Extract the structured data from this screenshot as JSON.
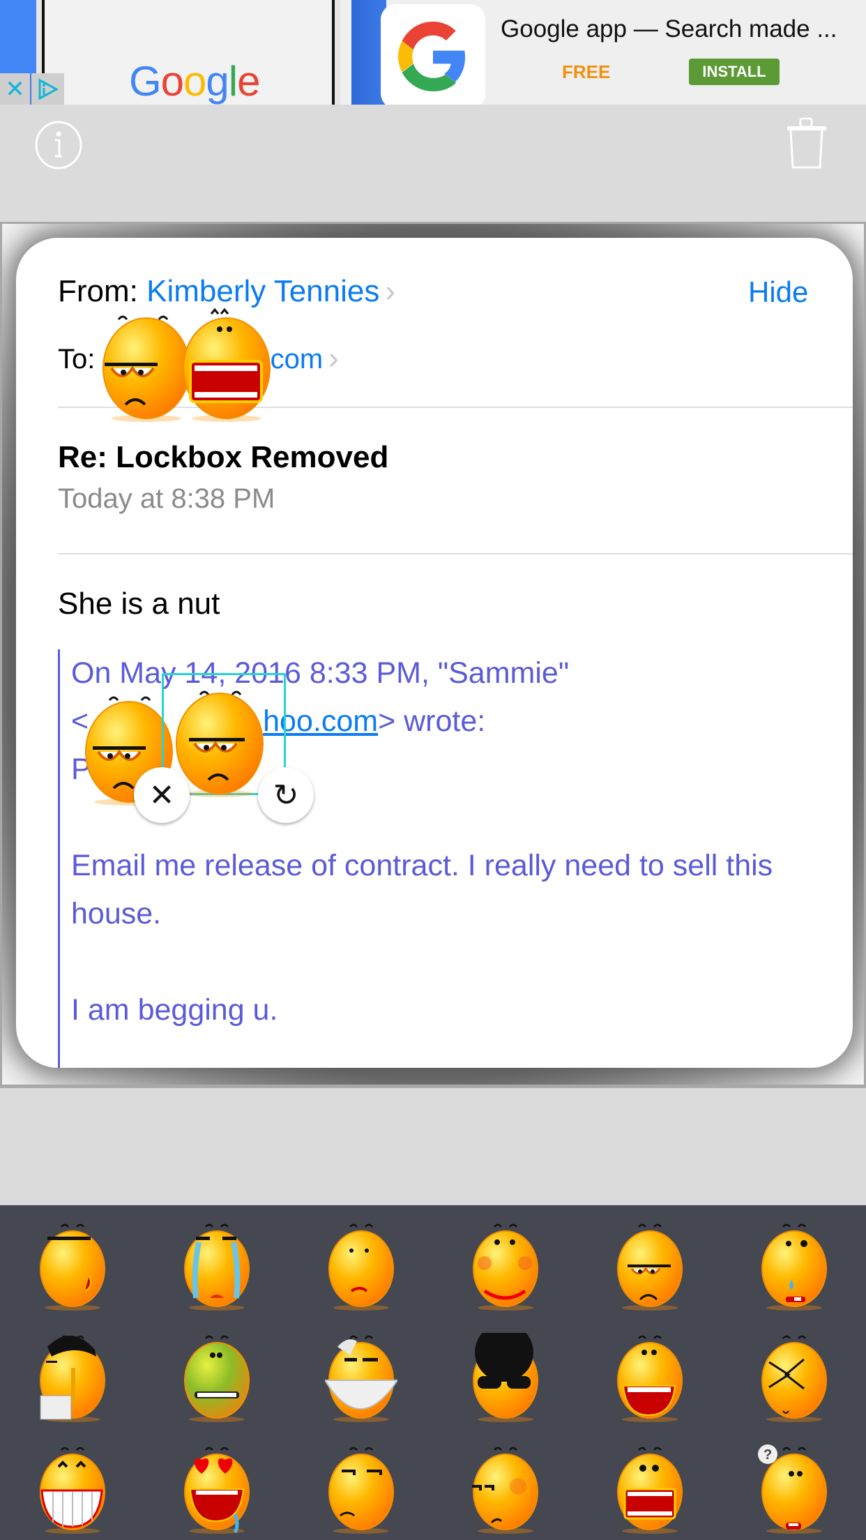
{
  "ad": {
    "brand_word": [
      "G",
      "o",
      "o",
      "g",
      "l",
      "e"
    ],
    "title": "Google app — Search made ...",
    "price": "FREE",
    "install_label": "INSTALL",
    "close_glyph": "✕",
    "colors": {
      "blue": "#4285f4",
      "red": "#ea4335",
      "yellow": "#fbbc05",
      "green": "#34a853",
      "install_bg": "#5c9a35",
      "free": "#f0900c"
    }
  },
  "toolbar": {
    "info_icon": "info-icon",
    "trash_icon": "trash-icon"
  },
  "email": {
    "from_label": "From:",
    "from_name": "Kimberly Tennies",
    "hide_label": "Hide",
    "to_label": "To:",
    "to_address_visible": "ahoo.com",
    "subject": "Re: Lockbox Removed",
    "date": "Today at 8:38 PM",
    "body": "She is a nut",
    "quote": {
      "header_line1": "On May 14, 2016 8:33 PM, \"Sammie\"",
      "header_line2_prefix": "<",
      "header_line2_link": "hoo.com",
      "header_line2_suffix": "> wrote:",
      "line3_fragment": "Pl",
      "para1": "Email me release of contract.  I really need to sell this house.",
      "para2": "I am begging u."
    },
    "colors": {
      "link": "#0a7bf2",
      "quote": "#5b5bd6",
      "date": "#8a8a8a"
    }
  },
  "placed_stickers": [
    {
      "name": "annoyed-face",
      "region": "header"
    },
    {
      "name": "shouting-face",
      "region": "header"
    },
    {
      "name": "annoyed-face",
      "region": "quote"
    },
    {
      "name": "annoyed-face",
      "region": "quote",
      "selected": true
    }
  ],
  "sticker_controls": {
    "delete_glyph": "✕",
    "rotate_glyph": "↻"
  },
  "emoji_picker": {
    "items": [
      "sunglasses-smirk",
      "crying",
      "shrug-worried",
      "blushing-smile",
      "annoyed",
      "nervous-sweat",
      "headbanger-facepalm",
      "sick-green",
      "hatching-egg",
      "afro-rocker",
      "laughing",
      "squint-x-eyes",
      "big-grin",
      "heart-eyes-drool",
      "unimpressed",
      "sideglance-smirk",
      "shouting",
      "confused-question"
    ]
  }
}
